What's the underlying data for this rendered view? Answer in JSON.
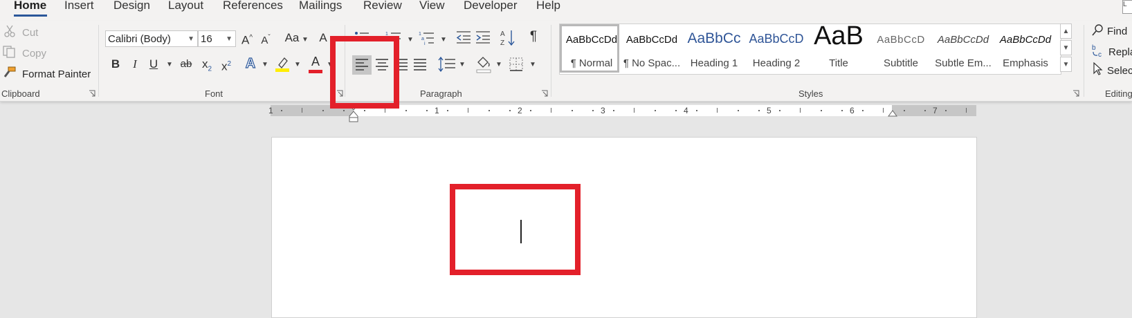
{
  "tabs": [
    "Home",
    "Insert",
    "Design",
    "Layout",
    "References",
    "Mailings",
    "Review",
    "View",
    "Developer",
    "Help"
  ],
  "corner_text": "L",
  "clipboard": {
    "label": "Clipboard",
    "cut": "Cut",
    "copy": "Copy",
    "format_painter": "Format Painter"
  },
  "font": {
    "label": "Font",
    "font_name": "Calibri (Body)",
    "font_size": "16",
    "change_case": "Aa",
    "bold": "B",
    "italic": "I",
    "underline": "U",
    "strike": "ab",
    "sub": "x",
    "sub_mark": "2",
    "sup": "x",
    "sup_mark": "2",
    "text_effects": "A",
    "font_color": "A",
    "grow": "A",
    "shrink": "A",
    "clear": "A"
  },
  "paragraph": {
    "label": "Paragraph",
    "pilcrow": "¶"
  },
  "styles": {
    "label": "Styles",
    "items": [
      {
        "preview": "AaBbCcDd",
        "name": "¶ Normal"
      },
      {
        "preview": "AaBbCcDd",
        "name": "¶ No Spac..."
      },
      {
        "preview": "AaBbCc",
        "name": "Heading 1"
      },
      {
        "preview": "AaBbCcD",
        "name": "Heading 2"
      },
      {
        "preview": "AaB",
        "name": "Title"
      },
      {
        "preview": "AaBbCcD",
        "name": "Subtitle"
      },
      {
        "preview": "AaBbCcDd",
        "name": "Subtle Em..."
      },
      {
        "preview": "AaBbCcDd",
        "name": "Emphasis"
      }
    ]
  },
  "editing": {
    "label": "Editing",
    "find": "Find",
    "replace": "Repla",
    "select": "Selec"
  },
  "ruler": {
    "numbers": [
      "1",
      "1",
      "2",
      "3",
      "4",
      "5",
      "6",
      "7"
    ]
  },
  "colors": {
    "highlight": "#ffee00",
    "font_color_bar": "#e3202a",
    "annotation": "#e3202a",
    "accent": "#2b579a"
  }
}
